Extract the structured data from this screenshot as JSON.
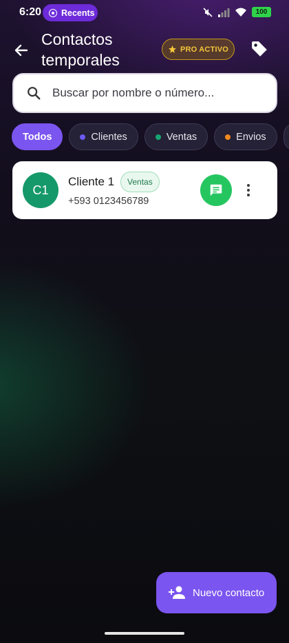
{
  "status_bar": {
    "time": "6:20",
    "recents_label": "Recents",
    "battery": "100"
  },
  "header": {
    "title": "Contactos temporales",
    "pro_badge": "PRO ACTIVO"
  },
  "search": {
    "placeholder": "Buscar por nombre o número...",
    "value": ""
  },
  "filters": [
    {
      "label": "Todos",
      "active": true,
      "color": ""
    },
    {
      "label": "Clientes",
      "active": false,
      "color": "#6b5bf2"
    },
    {
      "label": "Ventas",
      "active": false,
      "color": "#17a673"
    },
    {
      "label": "Envios",
      "active": false,
      "color": "#f08a1d"
    },
    {
      "label": "",
      "active": false,
      "color": ""
    }
  ],
  "contacts": [
    {
      "initials": "C1",
      "name": "Cliente 1",
      "tag": "Ventas",
      "phone": "+593 0123456789",
      "avatar_color": "#16996a"
    }
  ],
  "fab": {
    "label": "Nuevo contacto"
  },
  "colors": {
    "accent": "#7b55ef",
    "pro_gold": "#f4c53a",
    "whatsapp_green": "#25c660"
  }
}
